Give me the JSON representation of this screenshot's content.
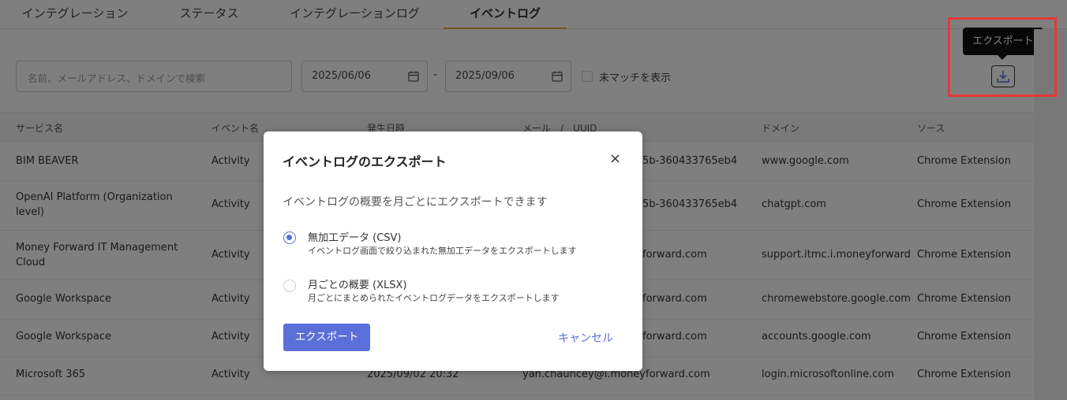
{
  "tabs": [
    {
      "label": "インテグレーション"
    },
    {
      "label": "ステータス"
    },
    {
      "label": "インテグレーションログ"
    },
    {
      "label": "イベントログ"
    }
  ],
  "filters": {
    "search_placeholder": "名前、メールアドレス、ドメインで検索",
    "date_from": "2025/06/06",
    "date_separator": "-",
    "date_to": "2025/09/06",
    "unmatched_label": "未マッチを表示"
  },
  "export": {
    "tooltip": "エクスポート",
    "icon": "download-icon"
  },
  "table": {
    "headers": [
      "サービス名",
      "イベント名",
      "発生日時",
      "メール　/　UUID",
      "ドメイン",
      "ソース"
    ],
    "rows": [
      {
        "service": "BIM BEAVER",
        "event": "Activity",
        "date": "",
        "email": "5b-360433765eb4",
        "domain": "www.google.com",
        "source": "Chrome Extension"
      },
      {
        "service": "OpenAI Platform (Organization level)",
        "event": "Activity",
        "date": "",
        "email": "5b-360433765eb4",
        "domain": "chatgpt.com",
        "source": "Chrome Extension"
      },
      {
        "service": "Money Forward IT Management Cloud",
        "event": "Activity",
        "date": "",
        "email": "forward.com",
        "domain": "support.itmc.i.moneyforward",
        "source": "Chrome Extension"
      },
      {
        "service": "Google Workspace",
        "event": "Activity",
        "date": "",
        "email": "forward.com",
        "domain": "chromewebstore.google.com",
        "source": "Chrome Extension"
      },
      {
        "service": "Google Workspace",
        "event": "Activity",
        "date": "",
        "email": "forward.com",
        "domain": "accounts.google.com",
        "source": "Chrome Extension"
      },
      {
        "service": "Microsoft 365",
        "event": "Activity",
        "date": "2025/09/02 20:32",
        "email": "yan.chauncey@i.moneyforward.com",
        "domain": "login.microsoftonline.com",
        "source": "Chrome Extension"
      }
    ]
  },
  "modal": {
    "title": "イベントログのエクスポート",
    "close": "×",
    "description": "イベントログの概要を月ごとにエクスポートできます",
    "options": [
      {
        "title": "無加工データ (CSV)",
        "subtitle": "イベントログ画面で絞り込まれた無加工データをエクスポートします",
        "selected": true
      },
      {
        "title": "月ごとの概要 (XLSX)",
        "subtitle": "月ごとにまとめられたイベントログデータをエクスポートします",
        "selected": false
      }
    ],
    "export_label": "エクスポート",
    "cancel_label": "キャンセル"
  },
  "colors": {
    "accent": "#5b6fd8",
    "tab_active": "#e8a33d",
    "highlight": "#e53935"
  }
}
